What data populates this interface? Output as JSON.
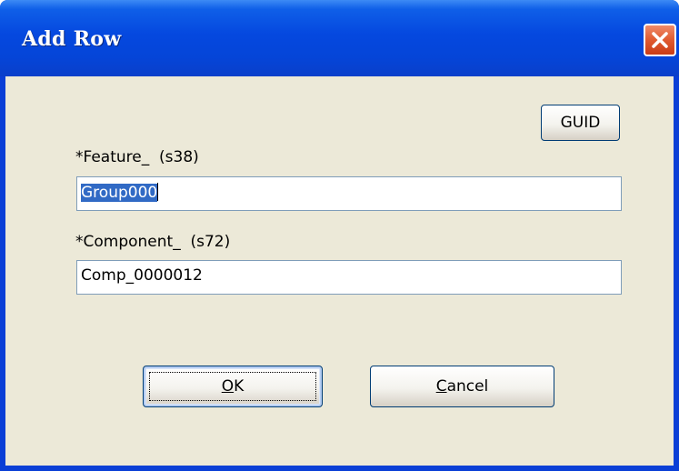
{
  "window": {
    "title": "Add Row",
    "close_icon": "close-icon"
  },
  "dialog": {
    "guid_button_label": "GUID",
    "feature": {
      "label": "*Feature_  (s38)",
      "value": "Group000",
      "selected": true
    },
    "component": {
      "label": "*Component_  (s72)",
      "value": "Comp_0000012"
    },
    "ok_label": "OK",
    "cancel_label": "Cancel"
  },
  "colors": {
    "titlebar": "#0548df",
    "client_bg": "#ece9d8",
    "selection": "#316ac5",
    "close_button": "#e05a30"
  }
}
